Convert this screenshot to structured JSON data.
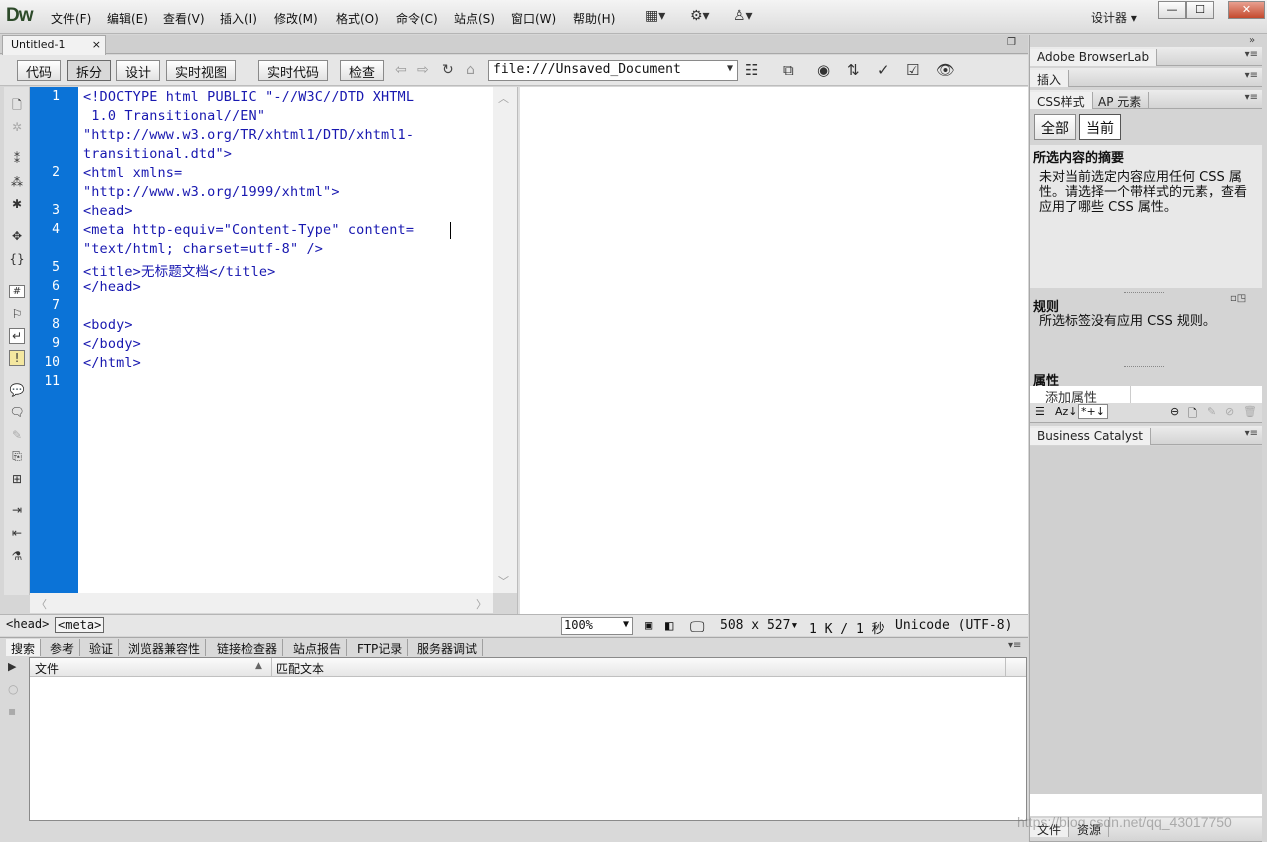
{
  "app": {
    "logo": "Dw",
    "workspace": "设计器",
    "workspace_arrow": "▾"
  },
  "menu": [
    "文件(F)",
    "编辑(E)",
    "查看(V)",
    "插入(I)",
    "修改(M)",
    "格式(O)",
    "命令(C)",
    "站点(S)",
    "窗口(W)",
    "帮助(H)"
  ],
  "window_buttons": {
    "minimize": "—",
    "maximize": "☐",
    "close": "✕"
  },
  "document_tab": {
    "title": "Untitled-1",
    "close": "×"
  },
  "view_buttons": {
    "code": "代码",
    "split": "拆分",
    "design": "设计",
    "live_view": "实时视图",
    "live_code": "实时代码",
    "inspect": "检查"
  },
  "url": "file:///Unsaved_Document",
  "gutter_lines": [
    "1",
    "2",
    "3",
    "4",
    "5",
    "6",
    "7",
    "8",
    "9",
    "10",
    "11"
  ],
  "code_lines": [
    "<!DOCTYPE html PUBLIC \"-//W3C//DTD XHTML",
    " 1.0 Transitional//EN\"",
    "\"http://www.w3.org/TR/xhtml1/DTD/xhtml1-",
    "transitional.dtd\">",
    "<html xmlns=",
    "\"http://www.w3.org/1999/xhtml\">",
    "<head>",
    "<meta http-equiv=\"Content-Type\" content=",
    "\"text/html; charset=utf-8\" />",
    "<title>无标题文档</title>",
    "</head>",
    "",
    "<body>",
    "</body>",
    "</html>"
  ],
  "status": {
    "tag1": "<head>",
    "tag2": "<meta>",
    "zoom": "100%",
    "size": "508 x 527",
    "size_arrow": "▾",
    "download": "1 K / 1 秒",
    "encoding": "Unicode (UTF-8)"
  },
  "bottom_tabs": [
    "搜索",
    "参考",
    "验证",
    "浏览器兼容性",
    "链接检查器",
    "站点报告",
    "FTP记录",
    "服务器调试"
  ],
  "results": {
    "col_file": "文件",
    "col_match": "匹配文本"
  },
  "right_panel": {
    "browserlab": "Adobe BrowserLab",
    "insert": "插入",
    "css_tab": "CSS样式",
    "ap_tab": "AP 元素",
    "btn_all": "全部",
    "btn_current": "当前",
    "summary_title": "所选内容的摘要",
    "summary_text": "未对当前选定内容应用任何 CSS 属性。请选择一个带样式的元素，查看应用了哪些 CSS 属性。",
    "rules_title": "规则",
    "rules_text": "所选标签没有应用 CSS 规则。",
    "props_title": "属性",
    "add_prop": "添加属性",
    "business": "Business Catalyst",
    "files_tab": "文件",
    "assets_tab": "资源"
  },
  "watermark": "https://blog.csdn.net/qq_43017750"
}
